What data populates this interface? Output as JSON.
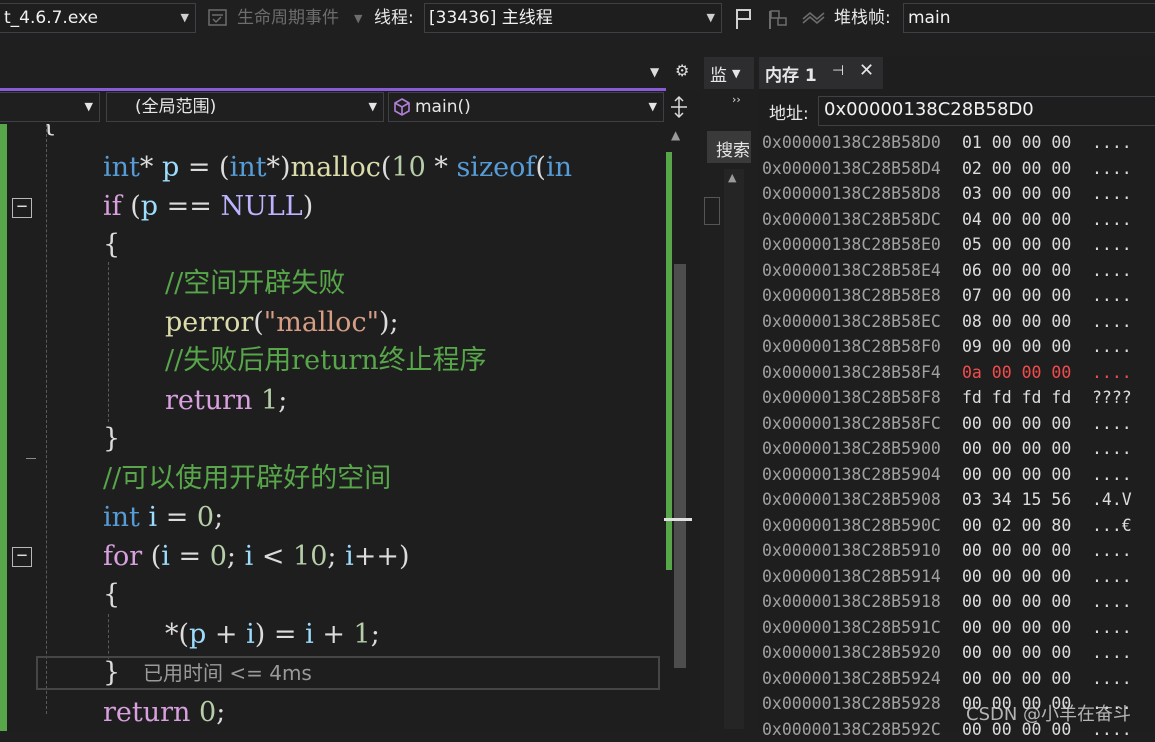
{
  "toolbar": {
    "process": "t_4.6.7.exe",
    "lifecycle_label": "生命周期事件",
    "thread_label": "线程:",
    "thread_value": "[33436] 主线程",
    "stackframe_label": "堆栈帧:",
    "stackframe_value": "main"
  },
  "editor": {
    "scope_combo": "(全局范围)",
    "function_combo": "main()",
    "elapsed_hint": "已用时间 <= 4ms"
  },
  "watch": {
    "tab_label": "监",
    "search_label": "搜索"
  },
  "memory": {
    "tab_title": "内存 1",
    "address_label": "地址:",
    "address_value": "0x00000138C28B58D0",
    "rows": [
      {
        "addr": "0x00000138C28B58D0",
        "bytes": "01 00 00 00",
        "chars": "...."
      },
      {
        "addr": "0x00000138C28B58D4",
        "bytes": "02 00 00 00",
        "chars": "...."
      },
      {
        "addr": "0x00000138C28B58D8",
        "bytes": "03 00 00 00",
        "chars": "...."
      },
      {
        "addr": "0x00000138C28B58DC",
        "bytes": "04 00 00 00",
        "chars": "...."
      },
      {
        "addr": "0x00000138C28B58E0",
        "bytes": "05 00 00 00",
        "chars": "...."
      },
      {
        "addr": "0x00000138C28B58E4",
        "bytes": "06 00 00 00",
        "chars": "...."
      },
      {
        "addr": "0x00000138C28B58E8",
        "bytes": "07 00 00 00",
        "chars": "...."
      },
      {
        "addr": "0x00000138C28B58EC",
        "bytes": "08 00 00 00",
        "chars": "...."
      },
      {
        "addr": "0x00000138C28B58F0",
        "bytes": "09 00 00 00",
        "chars": "...."
      },
      {
        "addr": "0x00000138C28B58F4",
        "bytes": "0a 00 00 00",
        "chars": "....",
        "changed": true
      },
      {
        "addr": "0x00000138C28B58F8",
        "bytes": "fd fd fd fd",
        "chars": "????"
      },
      {
        "addr": "0x00000138C28B58FC",
        "bytes": "00 00 00 00",
        "chars": "...."
      },
      {
        "addr": "0x00000138C28B5900",
        "bytes": "00 00 00 00",
        "chars": "...."
      },
      {
        "addr": "0x00000138C28B5904",
        "bytes": "00 00 00 00",
        "chars": "...."
      },
      {
        "addr": "0x00000138C28B5908",
        "bytes": "03 34 15 56",
        "chars": ".4.V"
      },
      {
        "addr": "0x00000138C28B590C",
        "bytes": "00 02 00 80",
        "chars": "...€"
      },
      {
        "addr": "0x00000138C28B5910",
        "bytes": "00 00 00 00",
        "chars": "...."
      },
      {
        "addr": "0x00000138C28B5914",
        "bytes": "00 00 00 00",
        "chars": "...."
      },
      {
        "addr": "0x00000138C28B5918",
        "bytes": "00 00 00 00",
        "chars": "...."
      },
      {
        "addr": "0x00000138C28B591C",
        "bytes": "00 00 00 00",
        "chars": "...."
      },
      {
        "addr": "0x00000138C28B5920",
        "bytes": "00 00 00 00",
        "chars": "...."
      },
      {
        "addr": "0x00000138C28B5924",
        "bytes": "00 00 00 00",
        "chars": "...."
      },
      {
        "addr": "0x00000138C28B5928",
        "bytes": "00 00 00 00",
        "chars": "...."
      },
      {
        "addr": "0x00000138C28B592C",
        "bytes": "00 00 00 00",
        "chars": "...."
      }
    ]
  },
  "watermark": "CSDN @小羊在奋斗",
  "colors": {
    "accent": "#8a5bd6",
    "changed_bar": "#57a64a",
    "changed_value": "#f14c4c"
  }
}
